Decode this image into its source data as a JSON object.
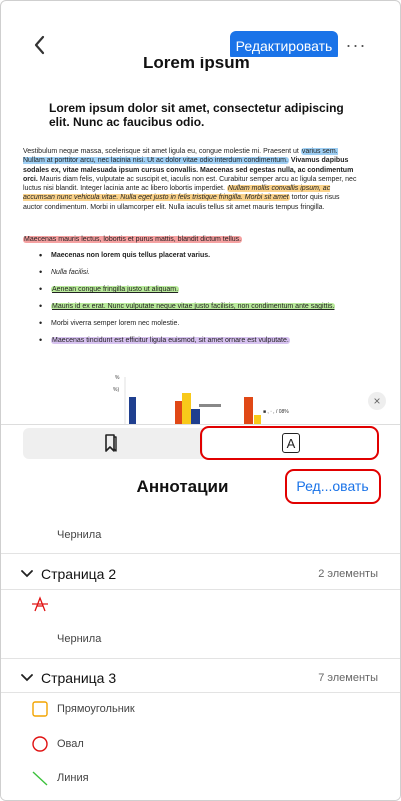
{
  "nav": {
    "edit_label": "Редактировать",
    "more_label": "···"
  },
  "document": {
    "cutoff_title": "Lorem ipsum",
    "heading": "Lorem ipsum dolor sit amet, consectetur adipiscing elit. Nunc ac faucibus odio.",
    "p1_a": "Vestibulum neque massa, scelerisque sit amet ligula eu, congue molestie mi. Praesent ut ",
    "p1_hl_blue": "varius sem. Nullam at porttitor arcu, nec lacinia nisi. Ut ac dolor vitae odio interdum condimentum.",
    "p1_bold": " Vivamus dapibus sodales ex, vitae malesuada ipsum cursus convallis. Maecenas sed egestas nulla, ac condimentum orci.",
    "p1_b": " Mauris diam felis, vulputate ac suscipit et, iaculis non est. Curabitur semper arcu ac ligula semper, nec luctus nisi blandit. Integer lacinia ante ac libero lobortis imperdiet. ",
    "p1_hl_orange": "Nullam mollis convallis ipsum, ac accumsan nunc vehicula vitae. Nulla eget justo in felis tristique fringilla. Morbi sit amet",
    "p1_c": " tortor quis risus auctor condimentum. Morbi in ullamcorper elit. Nulla iaculis tellus sit amet mauris tempus fringilla.",
    "p2": "Maecenas mauris lectus, lobortis et purus mattis, blandit dictum tellus.",
    "list": [
      "Maecenas non lorem quis tellus placerat varius.",
      "Nulla facilisi.",
      "Aenean congue fringilla justo ut aliquam.",
      "Mauris id ex erat. Nunc vulputate neque vitae justo facilisis, non condimentum ante sagittis.",
      "Morbi viverra semper lorem nec molestie.",
      "Maecenas tincidunt est efficitur ligula euismod, sit amet ornare est vulputate."
    ],
    "chart_axis_a": "%",
    "chart_axis_b": "%)",
    "chart_legend": "■ , ‧ ,  / 08%"
  },
  "close_label": "×",
  "sheet": {
    "title": "Аннотации",
    "edit_label": "Ред...овать",
    "ink_label_1": "Чернила",
    "page2": {
      "name": "Страница 2",
      "count": "2 элементы"
    },
    "ink_label_2": "Чернила",
    "page3": {
      "name": "Страница 3",
      "count": "7 элементы"
    },
    "items": [
      "Прямоугольник",
      "Овал",
      "Линия"
    ]
  },
  "colors": {
    "accent": "#1a73e8",
    "highlight_red": "#e10000"
  },
  "icons": [
    "back-chevron-icon",
    "more-icon",
    "bookmark-icon",
    "annotation-a-icon",
    "chevron-down-icon",
    "strikethrough-icon",
    "rectangle-icon",
    "oval-icon",
    "line-icon",
    "close-icon"
  ]
}
